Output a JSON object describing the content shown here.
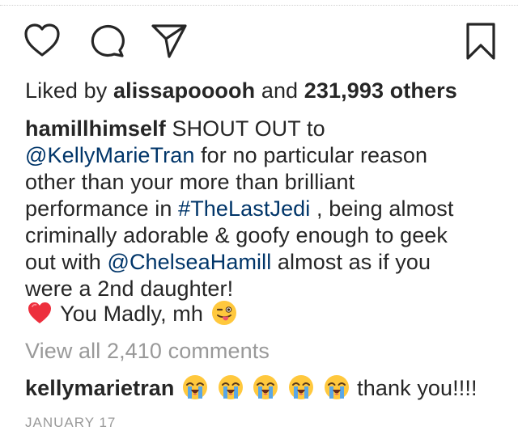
{
  "actions": {
    "like_icon": "heart-outline-icon",
    "comment_icon": "speech-bubble-icon",
    "share_icon": "paper-plane-icon",
    "save_icon": "bookmark-outline-icon"
  },
  "likes": {
    "prefix": "Liked by",
    "user": "alissapooooh",
    "middle": "and",
    "count": "231,993 others"
  },
  "caption": {
    "author": "hamillhimself",
    "l1_text": " SHOUT OUT to",
    "l2_mention": "@KellyMarieTran",
    "l2_text": " for no particular reason",
    "l3": "other than your more than brilliant",
    "l4_text": "performance in ",
    "l4_hashtag": "#TheLastJedi",
    "l4_text2": " , being almost",
    "l5": "criminally adorable & goofy enough to geek",
    "l6_text": "out with ",
    "l6_mention": "@ChelseaHamill",
    "l6_text2": " almost as if you",
    "l7": "were a 2nd daughter!",
    "l8_text": " You Madly, mh ",
    "heart_emoji": "red-heart-emoji",
    "wink_emoji": "winking-face-with-tongue-emoji"
  },
  "view_all": "View all 2,410 comments",
  "comment": {
    "user": "kellymarietran",
    "emoji": "loudly-crying-face-emoji",
    "emoji_count": 5,
    "text": " thank you!!!!"
  },
  "date": "JANUARY 17",
  "colors": {
    "text": "#262626",
    "link": "#003569",
    "muted": "#999999",
    "heart": "#ed2f3d",
    "emoji_yellow": "#ffc83d",
    "tears": "#5aa7e6"
  }
}
